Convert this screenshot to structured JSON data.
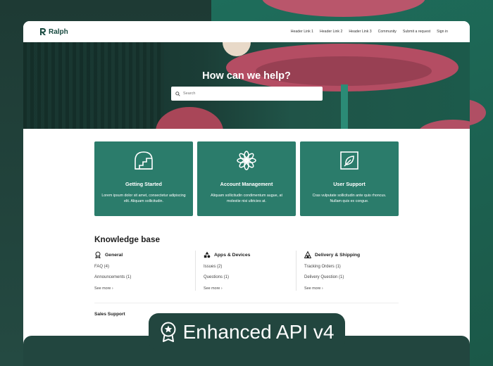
{
  "brand": {
    "name": "Ralph"
  },
  "nav": [
    {
      "label": "Header Link 1"
    },
    {
      "label": "Header Link 2"
    },
    {
      "label": "Header Link 3"
    },
    {
      "label": "Community"
    },
    {
      "label": "Submit a request"
    },
    {
      "label": "Sign in"
    }
  ],
  "hero": {
    "title": "How can we help?"
  },
  "search": {
    "placeholder": "Search"
  },
  "cards": [
    {
      "icon": "stairs-arch-icon",
      "title": "Getting Started",
      "description": "Lorem ipsum dolor sit amet, consectetur adipiscing elit. Aliquam sollicitudin."
    },
    {
      "icon": "flower-icon",
      "title": "Account Management",
      "description": "Aliquam sollicitudin condimentum augue, at molestie nisi ultricies at."
    },
    {
      "icon": "leaf-icon",
      "title": "User Support",
      "description": "Cras vulputate sollicitudin ante quis rhoncus. Nullam quis ex congue."
    }
  ],
  "knowledge_base": {
    "title": "Knowledge base",
    "sections": [
      {
        "icon": "award-icon",
        "title": "General",
        "items": [
          "FAQ (4)",
          "Announcements (1)"
        ],
        "more": "See more ›"
      },
      {
        "icon": "shapes-icon",
        "title": "Apps & Devices",
        "items": [
          "Issues (2)",
          "Questions (1)"
        ],
        "more": "See more ›"
      },
      {
        "icon": "tent-icon",
        "title": "Delivery & Shipping",
        "items": [
          "Tracking Orders (1)",
          "Delivery Question (1)"
        ],
        "more": "See more ›"
      }
    ],
    "next_section": "Sales Support"
  },
  "badge": {
    "icon": "star-medal-icon",
    "text": "Enhanced API v4"
  },
  "colors": {
    "brand": "#17493f",
    "card": "#2b7c6b",
    "background": "#24463f",
    "accent": "#b9566b"
  }
}
